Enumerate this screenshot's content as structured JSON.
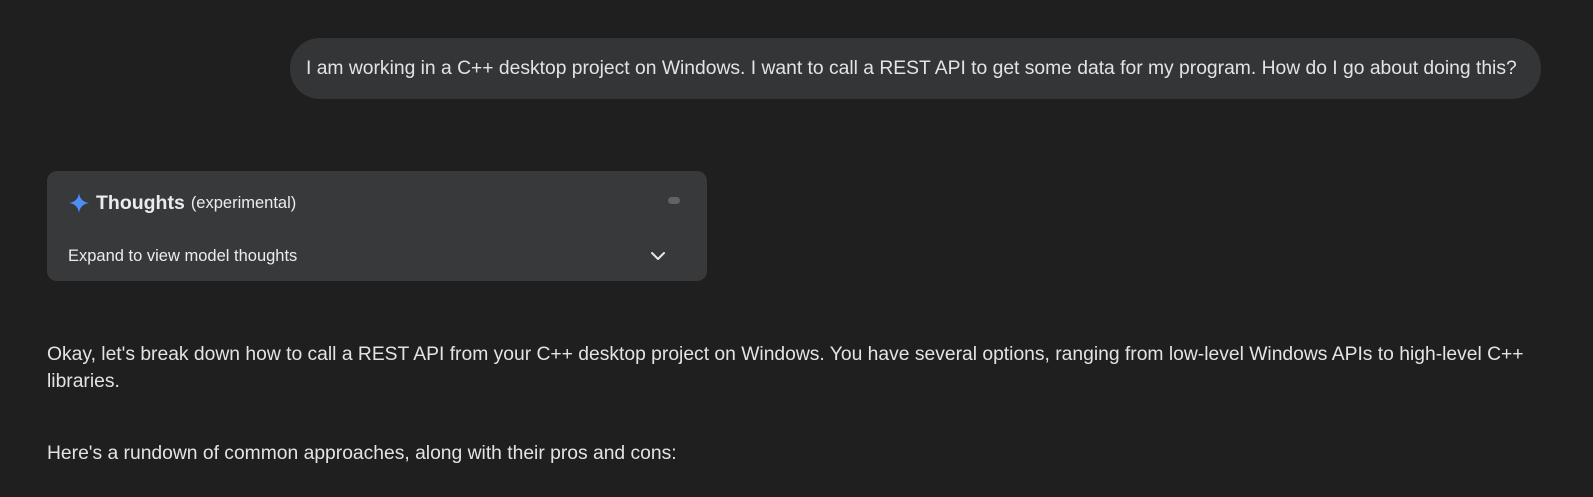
{
  "user_message": {
    "text": "I am working in a C++ desktop project on Windows. I want to call a REST API to get some data for my program. How do I go about doing this?"
  },
  "thoughts": {
    "title": "Thoughts",
    "subtitle": "(experimental)",
    "expand_label": "Expand to view model thoughts",
    "icons": {
      "title_icon": "sparkle-icon",
      "expand_icon": "chevron-down-icon"
    },
    "colors": {
      "sparkle": "#4c8df6"
    }
  },
  "response": {
    "paragraphs": [
      "Okay, let's break down how to call a REST API from your C++ desktop project on Windows. You have several options, ranging from low-level Windows APIs to high-level C++ libraries.",
      "Here's a rundown of common approaches, along with their pros and cons:"
    ]
  }
}
